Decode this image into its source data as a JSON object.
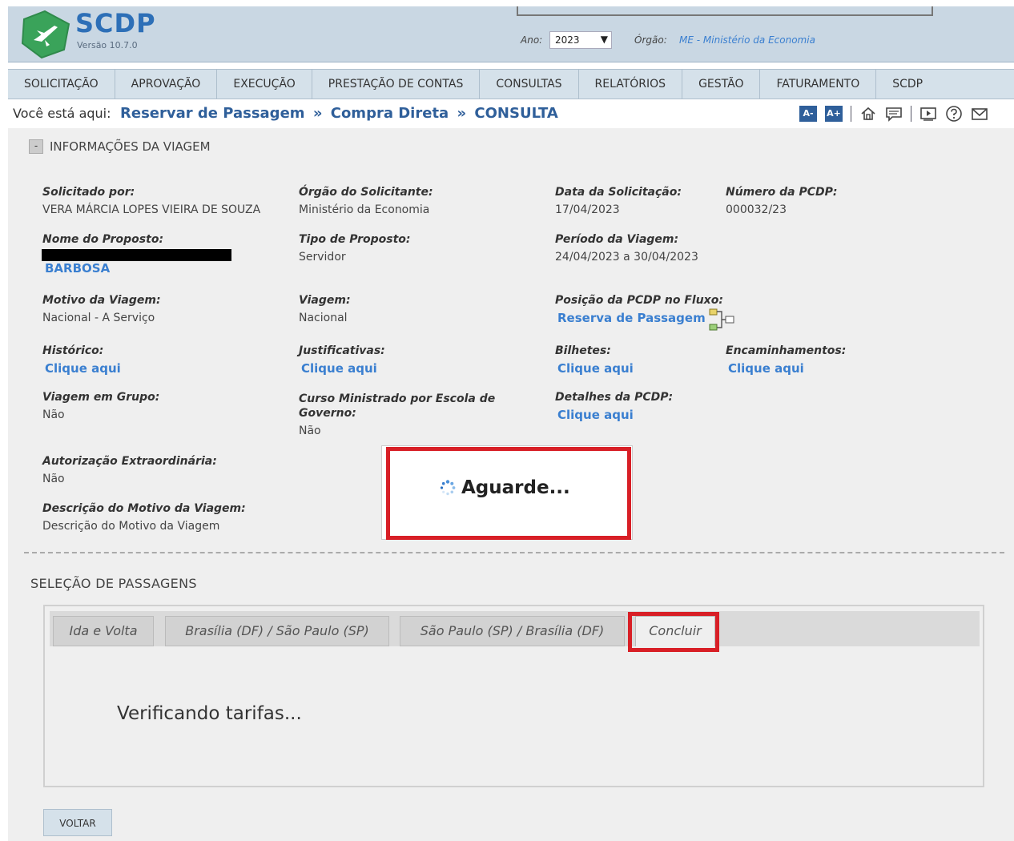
{
  "header": {
    "logo_text": "SCDP",
    "version": "Versão 10.7.0",
    "ano_label": "Ano:",
    "ano_value": "2023",
    "orgao_label": "Órgão:",
    "orgao_value": "ME - Ministério da Economia"
  },
  "menu": {
    "items": [
      "SOLICITAÇÃO",
      "APROVAÇÃO",
      "EXECUÇÃO",
      "PRESTAÇÃO DE CONTAS",
      "CONSULTAS",
      "RELATÓRIOS",
      "GESTÃO",
      "FATURAMENTO",
      "SCDP"
    ]
  },
  "breadcrumb": {
    "label": "Você está aqui:",
    "items": [
      "Reservar de Passagem",
      "Compra Direta",
      "CONSULTA"
    ],
    "separator": "»"
  },
  "toolbar": {
    "font_decrease": "A-",
    "font_increase": "A+"
  },
  "info": {
    "section_title": "INFORMAÇÕES DA VIAGEM",
    "collapse_symbol": "-",
    "solicitado_por_label": "Solicitado por:",
    "solicitado_por_value": "VERA MÁRCIA LOPES VIEIRA DE SOUZA",
    "orgao_solicitante_label": "Órgão do Solicitante:",
    "orgao_solicitante_value": "Ministério da Economia",
    "data_solicitacao_label": "Data da Solicitação:",
    "data_solicitacao_value": "17/04/2023",
    "numero_pcdp_label": "Número da PCDP:",
    "numero_pcdp_value": "000032/23",
    "nome_proposto_label": "Nome do Proposto:",
    "nome_proposto_value": "BARBOSA",
    "tipo_proposto_label": "Tipo de Proposto:",
    "tipo_proposto_value": "Servidor",
    "periodo_label": "Período da Viagem:",
    "periodo_value": "24/04/2023 a 30/04/2023",
    "motivo_label": "Motivo da Viagem:",
    "motivo_value": "Nacional - A Serviço",
    "viagem_label": "Viagem:",
    "viagem_value": "Nacional",
    "posicao_label": "Posição da PCDP no Fluxo:",
    "posicao_value": "Reserva de Passagem",
    "historico_label": "Histórico:",
    "justificativas_label": "Justificativas:",
    "bilhetes_label": "Bilhetes:",
    "encaminhamentos_label": "Encaminhamentos:",
    "clique_aqui": "Clique aqui",
    "grupo_label": "Viagem em Grupo:",
    "grupo_value": "Não",
    "curso_label": "Curso Ministrado por Escola de Governo:",
    "curso_value": "Não",
    "detalhes_label": "Detalhes da PCDP:",
    "autorizacao_label": "Autorização Extraordinária:",
    "autorizacao_value": "Não",
    "descricao_label": "Descrição do Motivo da Viagem:",
    "descricao_value": "Descrição do Motivo da Viagem"
  },
  "loading": {
    "text": "Aguarde..."
  },
  "selecao": {
    "title": "SELEÇÃO DE PASSAGENS",
    "tabs": [
      "Ida e Volta",
      "Brasília (DF) / São Paulo (SP)",
      "São Paulo (SP) / Brasília (DF)",
      "Concluir"
    ],
    "status_text": "Verificando tarifas..."
  },
  "actions": {
    "voltar": "VOLTAR"
  },
  "colors": {
    "link_blue": "#3a7fd0",
    "breadcrumb_blue": "#2f5f9a",
    "highlight_red": "#d81f26",
    "logo_green": "#3aa35a"
  }
}
